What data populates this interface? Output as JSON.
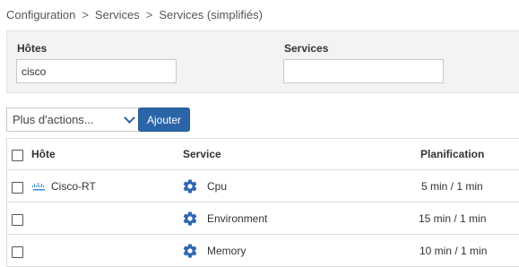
{
  "breadcrumb": {
    "items": [
      "Configuration",
      "Services",
      "Services (simplifiés)"
    ],
    "separator": ">"
  },
  "filters": {
    "hosts_label": "Hôtes",
    "hosts_value": "cisco",
    "services_label": "Services",
    "services_value": ""
  },
  "toolbar": {
    "more_actions_label": "Plus d'actions...",
    "add_label": "Ajouter"
  },
  "table": {
    "columns": {
      "host": "Hôte",
      "service": "Service",
      "schedule": "Planification"
    },
    "rows": [
      {
        "host": "Cisco-RT",
        "host_icon": "cisco-logo-icon",
        "service": "Cpu",
        "service_icon": "gear-icon",
        "schedule": "5 min / 1 min"
      },
      {
        "host": "",
        "host_icon": "",
        "service": "Environment",
        "service_icon": "gear-icon",
        "schedule": "15 min / 1 min"
      },
      {
        "host": "",
        "host_icon": "",
        "service": "Memory",
        "service_icon": "gear-icon",
        "schedule": "10 min / 1 min"
      }
    ]
  },
  "colors": {
    "accent": "#2b65a8",
    "gear": "#2f67b0",
    "panel_bg": "#f3f3f3",
    "border": "#dcdcdc"
  }
}
